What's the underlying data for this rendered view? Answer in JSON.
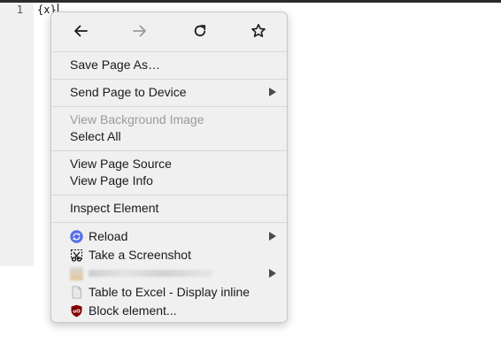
{
  "editor": {
    "line_number": "1",
    "code": "{x}"
  },
  "menu": {
    "nav": [
      {
        "name": "back",
        "icon": "arrow-left-icon",
        "enabled": true
      },
      {
        "name": "forward",
        "icon": "arrow-right-icon",
        "enabled": false
      },
      {
        "name": "reload",
        "icon": "reload-icon",
        "enabled": true
      },
      {
        "name": "bookmark",
        "icon": "star-icon",
        "enabled": true
      }
    ],
    "save_page_as": "Save Page As…",
    "send_page_to_device": "Send Page to Device",
    "view_background_image": "View Background Image",
    "select_all": "Select All",
    "view_page_source": "View Page Source",
    "view_page_info": "View Page Info",
    "inspect_element": "Inspect Element",
    "ext_reload": "Reload",
    "take_screenshot": "Take a Screenshot",
    "table_to_excel": "Table to Excel - Display inline",
    "block_element": "Block element..."
  },
  "colors": {
    "reload_icon": "#5a6ee6",
    "ublock_icon": "#800000",
    "screenshot_icon": "#111111"
  }
}
